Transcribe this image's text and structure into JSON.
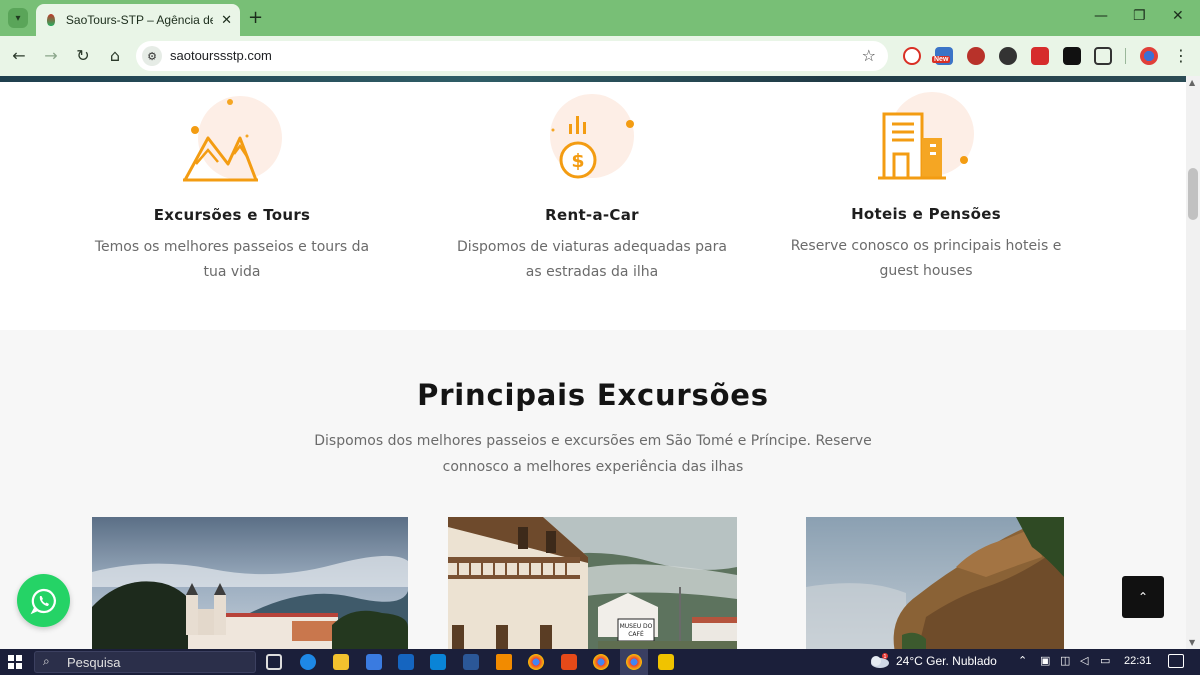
{
  "browser": {
    "tab_title": "SaoTours-STP – Agência de Turismo",
    "tab_close": "✕",
    "new_tab": "+",
    "url": "saotourssstp.com",
    "ext_badge": "New"
  },
  "services": [
    {
      "title": "Excursões e Tours",
      "description": "Temos os melhores passeios e tours da tua vida",
      "icon": "mountain-icon"
    },
    {
      "title": "Rent-a-Car",
      "description": "Dispomos de viaturas adequadas para as estradas da ilha",
      "icon": "money-icon"
    },
    {
      "title": "Hoteis e Pensões",
      "description": "Reserve conosco os principais hoteis e guest houses",
      "icon": "building-icon"
    }
  ],
  "excursions": {
    "title": "Principais Excursões",
    "subtitle": "Dispomos dos melhores passeios e excursões em São Tomé e Príncipe. Reserve connosco a melhores experiência das ilhas",
    "cards": [
      {
        "image": "cathedral-town-photo"
      },
      {
        "image": "museu-do-cafe-photo",
        "sign": "MUSEU DO CAFÉ"
      },
      {
        "image": "rocky-cliff-photo"
      }
    ]
  },
  "widgets": {
    "back_to_top": "⌃"
  },
  "taskbar": {
    "search_placeholder": "Pesquisa",
    "weather": "24°C  Ger. Nublado",
    "time": "22:31",
    "weather_badge": "1"
  },
  "colors": {
    "accent": "#f39c12",
    "icon_bg": "#fdeee6",
    "whatsapp": "#25d366",
    "tabstrip": "#78bf76"
  }
}
